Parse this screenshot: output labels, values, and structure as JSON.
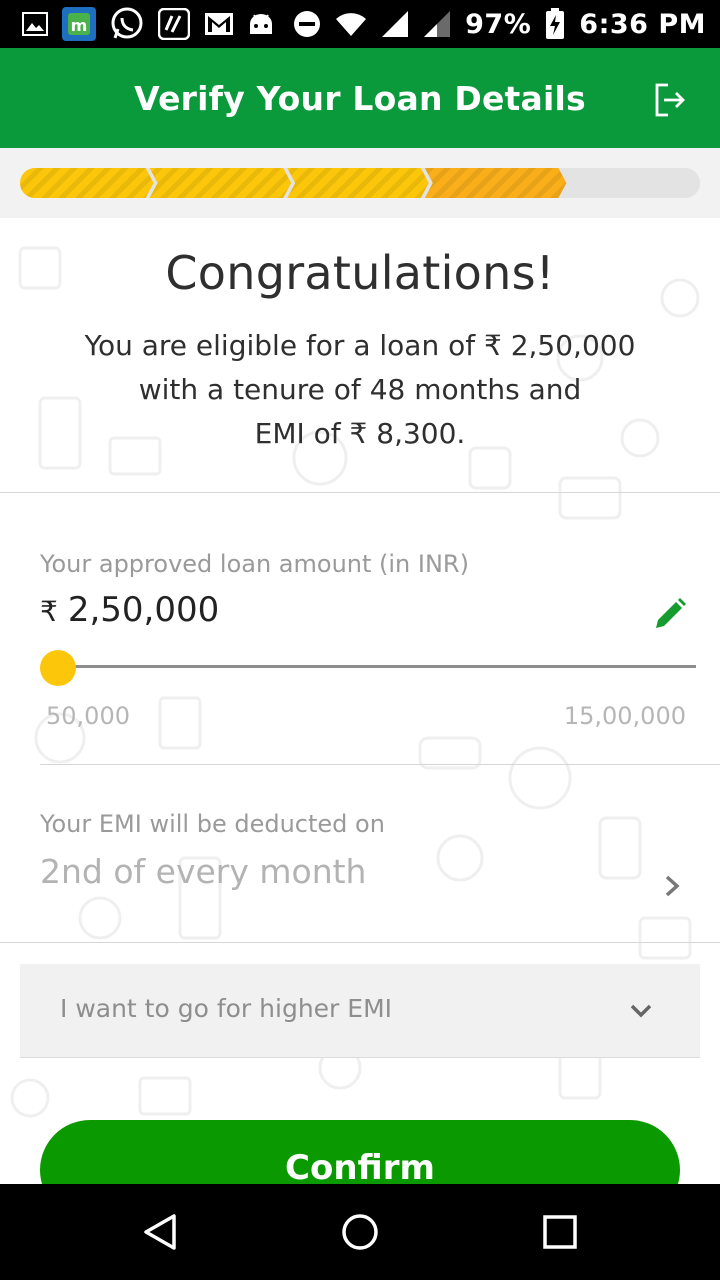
{
  "status_bar": {
    "battery": "97%",
    "time": "6:36 PM",
    "icons": [
      "gallery-icon",
      "m-app-icon",
      "whatsapp-icon",
      "saavn-icon",
      "gmail-icon",
      "android-icon",
      "dnd-icon",
      "wifi-icon",
      "signal-icon",
      "signal-weak-icon",
      "battery-charging-icon"
    ]
  },
  "app_bar": {
    "title": "Verify Your Loan Details",
    "action_icon": "logout-icon",
    "color": "#0a9a3c"
  },
  "progress": {
    "total_steps": 5,
    "completed_steps": 4,
    "colors": {
      "done": "#fcc60a",
      "current": "#f9ae1a",
      "pending": "#e3e3e3"
    }
  },
  "offer": {
    "title": "Congratulations!",
    "line1": "You are eligible for a loan of ₹ 2,50,000",
    "line2": "with a tenure of 48 months and",
    "line3": "EMI of ₹ 8,300."
  },
  "loan_amount": {
    "label": "Your approved loan amount (in INR)",
    "currency_symbol": "₹",
    "value": "2,50,000",
    "edit_icon": "pencil-icon",
    "slider_min": "50,000",
    "slider_max": "15,00,000",
    "slider_position": 0.0
  },
  "emi_date": {
    "label": "Your EMI will be deducted on",
    "value": "2nd of every month"
  },
  "higher_emi": {
    "label": "I want to go for higher EMI"
  },
  "confirm": {
    "label": "Confirm",
    "color": "#0a9a00"
  },
  "nav_bar": {
    "icons": [
      "back-icon",
      "home-icon",
      "recents-icon"
    ]
  }
}
